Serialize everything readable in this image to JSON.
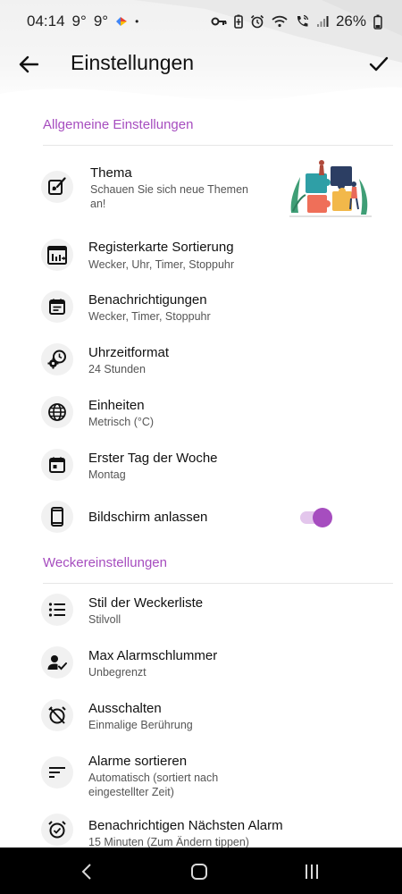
{
  "status_bar": {
    "time": "04:14",
    "weather_1": "9°",
    "weather_2": "9°",
    "dot": "•",
    "battery_percent": "26%"
  },
  "header": {
    "title": "Einstellungen"
  },
  "sections": {
    "general": {
      "label": "Allgemeine Einstellungen",
      "items": [
        {
          "title": "Thema",
          "subtitle": "Schauen Sie sich neue Themen an!",
          "icon": "paint-icon"
        },
        {
          "title": "Registerkarte Sortierung",
          "subtitle": "Wecker, Uhr, Timer, Stoppuhr",
          "icon": "tab-sort-icon"
        },
        {
          "title": "Benachrichtigungen",
          "subtitle": "Wecker, Timer, Stoppuhr",
          "icon": "notification-icon"
        },
        {
          "title": "Uhrzeitformat",
          "subtitle": "24 Stunden",
          "icon": "clock-gear-icon"
        },
        {
          "title": "Einheiten",
          "subtitle": "Metrisch (°C)",
          "icon": "globe-icon"
        },
        {
          "title": "Erster Tag der Woche",
          "subtitle": "Montag",
          "icon": "calendar-icon"
        },
        {
          "title": "Bildschirm anlassen",
          "icon": "phone-icon",
          "toggle_on": true
        }
      ]
    },
    "alarm": {
      "label": "Weckereinstellungen",
      "items": [
        {
          "title": "Stil der Weckerliste",
          "subtitle": "Stilvoll",
          "icon": "list-icon"
        },
        {
          "title": "Max Alarmschlummer",
          "subtitle": "Unbegrenzt",
          "icon": "person-check-icon"
        },
        {
          "title": "Ausschalten",
          "subtitle": "Einmalige Berührung",
          "icon": "alarm-off-icon"
        },
        {
          "title": "Alarme sortieren",
          "subtitle": "Automatisch (sortiert nach eingestellter Zeit)",
          "icon": "sort-icon"
        },
        {
          "title": "Benachrichtigen Nächsten Alarm",
          "subtitle": "15 Minuten (Zum Ändern tippen)",
          "icon": "alarm-check-icon"
        }
      ]
    }
  },
  "colors": {
    "accent": "#a64dbf",
    "accent_light": "#e3c6ec",
    "icon_bg": "#f1f1f1"
  }
}
